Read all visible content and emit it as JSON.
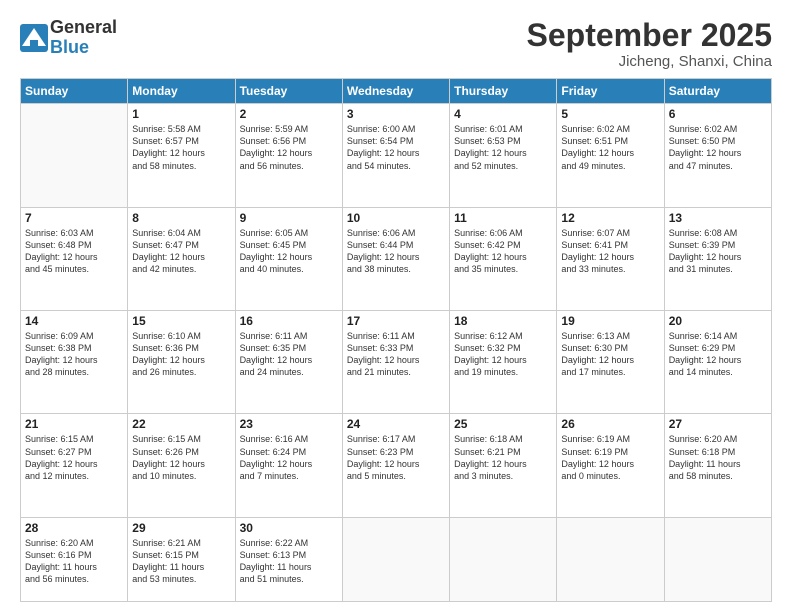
{
  "logo": {
    "general": "General",
    "blue": "Blue"
  },
  "header": {
    "title": "September 2025",
    "location": "Jicheng, Shanxi, China"
  },
  "days_of_week": [
    "Sunday",
    "Monday",
    "Tuesday",
    "Wednesday",
    "Thursday",
    "Friday",
    "Saturday"
  ],
  "weeks": [
    [
      {
        "day": "",
        "info": ""
      },
      {
        "day": "1",
        "info": "Sunrise: 5:58 AM\nSunset: 6:57 PM\nDaylight: 12 hours\nand 58 minutes."
      },
      {
        "day": "2",
        "info": "Sunrise: 5:59 AM\nSunset: 6:56 PM\nDaylight: 12 hours\nand 56 minutes."
      },
      {
        "day": "3",
        "info": "Sunrise: 6:00 AM\nSunset: 6:54 PM\nDaylight: 12 hours\nand 54 minutes."
      },
      {
        "day": "4",
        "info": "Sunrise: 6:01 AM\nSunset: 6:53 PM\nDaylight: 12 hours\nand 52 minutes."
      },
      {
        "day": "5",
        "info": "Sunrise: 6:02 AM\nSunset: 6:51 PM\nDaylight: 12 hours\nand 49 minutes."
      },
      {
        "day": "6",
        "info": "Sunrise: 6:02 AM\nSunset: 6:50 PM\nDaylight: 12 hours\nand 47 minutes."
      }
    ],
    [
      {
        "day": "7",
        "info": "Sunrise: 6:03 AM\nSunset: 6:48 PM\nDaylight: 12 hours\nand 45 minutes."
      },
      {
        "day": "8",
        "info": "Sunrise: 6:04 AM\nSunset: 6:47 PM\nDaylight: 12 hours\nand 42 minutes."
      },
      {
        "day": "9",
        "info": "Sunrise: 6:05 AM\nSunset: 6:45 PM\nDaylight: 12 hours\nand 40 minutes."
      },
      {
        "day": "10",
        "info": "Sunrise: 6:06 AM\nSunset: 6:44 PM\nDaylight: 12 hours\nand 38 minutes."
      },
      {
        "day": "11",
        "info": "Sunrise: 6:06 AM\nSunset: 6:42 PM\nDaylight: 12 hours\nand 35 minutes."
      },
      {
        "day": "12",
        "info": "Sunrise: 6:07 AM\nSunset: 6:41 PM\nDaylight: 12 hours\nand 33 minutes."
      },
      {
        "day": "13",
        "info": "Sunrise: 6:08 AM\nSunset: 6:39 PM\nDaylight: 12 hours\nand 31 minutes."
      }
    ],
    [
      {
        "day": "14",
        "info": "Sunrise: 6:09 AM\nSunset: 6:38 PM\nDaylight: 12 hours\nand 28 minutes."
      },
      {
        "day": "15",
        "info": "Sunrise: 6:10 AM\nSunset: 6:36 PM\nDaylight: 12 hours\nand 26 minutes."
      },
      {
        "day": "16",
        "info": "Sunrise: 6:11 AM\nSunset: 6:35 PM\nDaylight: 12 hours\nand 24 minutes."
      },
      {
        "day": "17",
        "info": "Sunrise: 6:11 AM\nSunset: 6:33 PM\nDaylight: 12 hours\nand 21 minutes."
      },
      {
        "day": "18",
        "info": "Sunrise: 6:12 AM\nSunset: 6:32 PM\nDaylight: 12 hours\nand 19 minutes."
      },
      {
        "day": "19",
        "info": "Sunrise: 6:13 AM\nSunset: 6:30 PM\nDaylight: 12 hours\nand 17 minutes."
      },
      {
        "day": "20",
        "info": "Sunrise: 6:14 AM\nSunset: 6:29 PM\nDaylight: 12 hours\nand 14 minutes."
      }
    ],
    [
      {
        "day": "21",
        "info": "Sunrise: 6:15 AM\nSunset: 6:27 PM\nDaylight: 12 hours\nand 12 minutes."
      },
      {
        "day": "22",
        "info": "Sunrise: 6:15 AM\nSunset: 6:26 PM\nDaylight: 12 hours\nand 10 minutes."
      },
      {
        "day": "23",
        "info": "Sunrise: 6:16 AM\nSunset: 6:24 PM\nDaylight: 12 hours\nand 7 minutes."
      },
      {
        "day": "24",
        "info": "Sunrise: 6:17 AM\nSunset: 6:23 PM\nDaylight: 12 hours\nand 5 minutes."
      },
      {
        "day": "25",
        "info": "Sunrise: 6:18 AM\nSunset: 6:21 PM\nDaylight: 12 hours\nand 3 minutes."
      },
      {
        "day": "26",
        "info": "Sunrise: 6:19 AM\nSunset: 6:19 PM\nDaylight: 12 hours\nand 0 minutes."
      },
      {
        "day": "27",
        "info": "Sunrise: 6:20 AM\nSunset: 6:18 PM\nDaylight: 11 hours\nand 58 minutes."
      }
    ],
    [
      {
        "day": "28",
        "info": "Sunrise: 6:20 AM\nSunset: 6:16 PM\nDaylight: 11 hours\nand 56 minutes."
      },
      {
        "day": "29",
        "info": "Sunrise: 6:21 AM\nSunset: 6:15 PM\nDaylight: 11 hours\nand 53 minutes."
      },
      {
        "day": "30",
        "info": "Sunrise: 6:22 AM\nSunset: 6:13 PM\nDaylight: 11 hours\nand 51 minutes."
      },
      {
        "day": "",
        "info": ""
      },
      {
        "day": "",
        "info": ""
      },
      {
        "day": "",
        "info": ""
      },
      {
        "day": "",
        "info": ""
      }
    ]
  ]
}
